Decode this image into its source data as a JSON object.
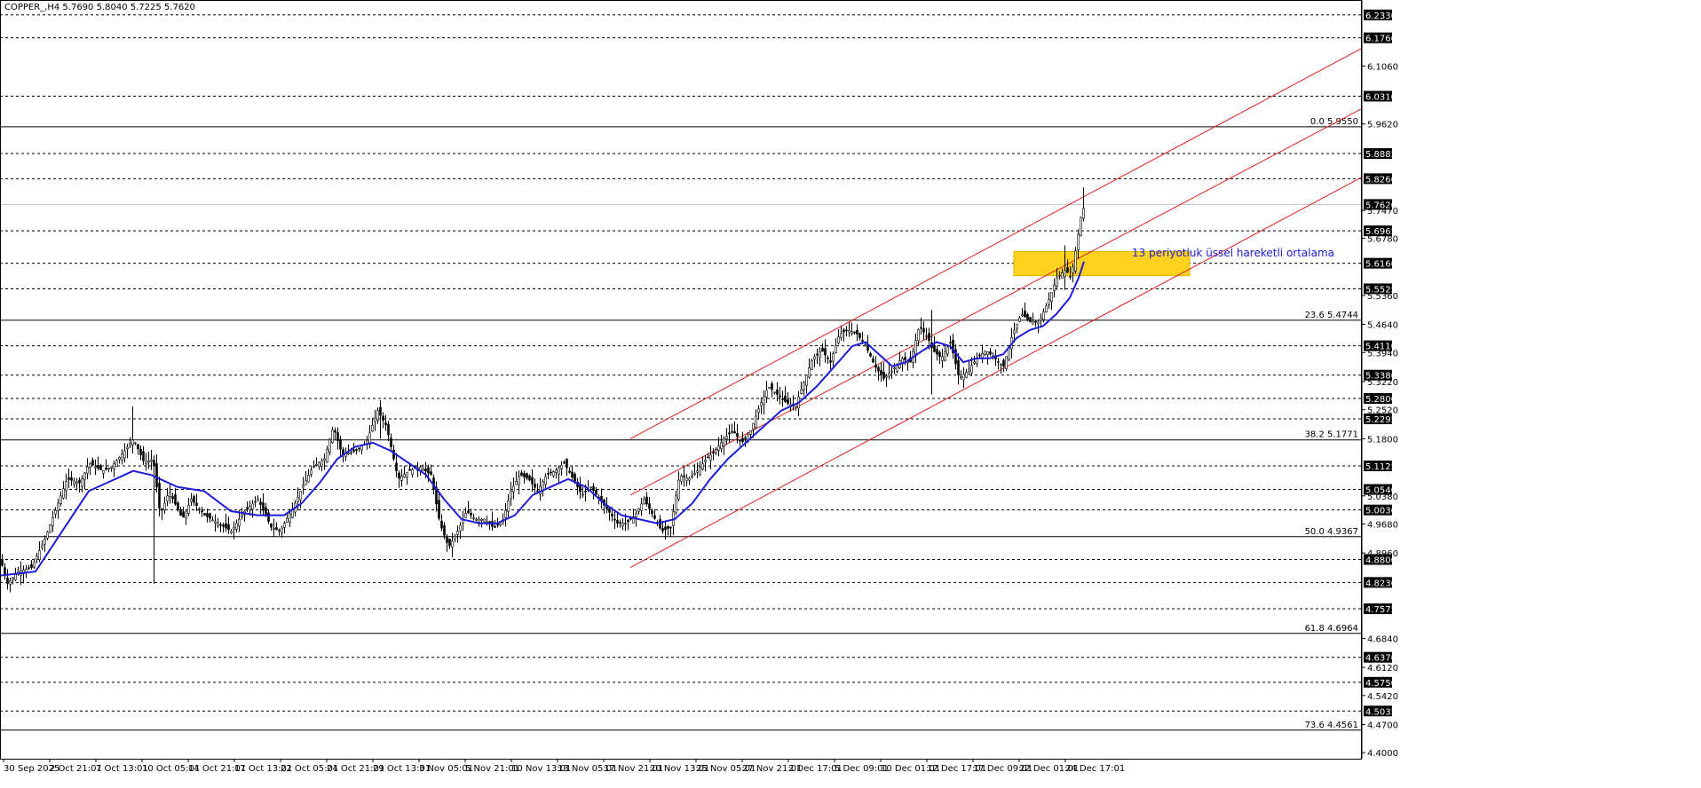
{
  "header": {
    "symbol_info": "COPPER_,H4  5.7690 5.8040 5.7225 5.7620"
  },
  "chart_data": {
    "type": "candlestick",
    "symbol": "COPPER_",
    "timeframe": "H4",
    "ohlc_header": {
      "open": 5.769,
      "high": 5.804,
      "low": 5.7225,
      "close": 5.762
    },
    "y_axis": {
      "min": 4.385,
      "max": 6.27
    },
    "y_ticks": [
      6.106,
      5.962,
      5.747,
      5.678,
      5.536,
      5.464,
      5.394,
      5.322,
      5.252,
      5.18,
      5.038,
      4.968,
      4.896,
      4.684,
      4.612,
      4.542,
      4.47,
      4.4
    ],
    "price_levels": [
      6.233,
      6.176,
      6.031,
      5.8885,
      5.826,
      5.762,
      5.6965,
      5.616,
      5.5525,
      5.411,
      5.338,
      5.28,
      5.2295,
      5.1125,
      5.054,
      5.003,
      4.88,
      4.823,
      4.7575,
      4.637,
      4.575,
      4.5035
    ],
    "dashed_levels": [
      6.233,
      6.176,
      6.031,
      5.8885,
      5.826,
      5.6965,
      5.616,
      5.5525,
      5.411,
      5.338,
      5.28,
      5.2295,
      5.1125,
      5.054,
      5.003,
      4.88,
      4.823,
      4.7575,
      4.637,
      4.575,
      4.5035
    ],
    "fibonacci": [
      {
        "label": "0.0 5.9550",
        "value": 5.955
      },
      {
        "label": "23.6 5.4744",
        "value": 5.4744
      },
      {
        "label": "38.2 5.1771",
        "value": 5.1771
      },
      {
        "label": "50.0 4.9367",
        "value": 4.9367
      },
      {
        "label": "61.8 4.6964",
        "value": 4.6964
      },
      {
        "label": "73.6 4.4561",
        "value": 4.4561
      }
    ],
    "x_tick_labels": [
      "30 Sep 2025",
      "2 Oct 21:01",
      "7 Oct 13:01",
      "10 Oct 05:01",
      "14 Oct 21:01",
      "17 Oct 13:01",
      "22 Oct 05:01",
      "24 Oct 21:01",
      "29 Oct 13:01",
      "3 Nov 05:01",
      "5 Nov 21:01",
      "10 Nov 13:01",
      "13 Nov 05:01",
      "17 Nov 21:01",
      "20 Nov 13:01",
      "25 Nov 05:01",
      "27 Nov 21:01",
      "2 Dec 17:01",
      "5 Dec 09:01",
      "10 Dec 01:01",
      "12 Dec 17:01",
      "17 Dec 09:01",
      "22 Dec 01:01",
      "24 Dec 17:01"
    ],
    "close_path": [
      [
        0,
        4.88
      ],
      [
        8,
        4.82
      ],
      [
        20,
        4.85
      ],
      [
        35,
        4.86
      ],
      [
        50,
        4.93
      ],
      [
        65,
        5.02
      ],
      [
        75,
        5.08
      ],
      [
        90,
        5.07
      ],
      [
        100,
        5.12
      ],
      [
        115,
        5.1
      ],
      [
        125,
        5.11
      ],
      [
        140,
        5.15
      ],
      [
        150,
        5.18
      ],
      [
        162,
        5.12
      ],
      [
        172,
        5.13
      ],
      [
        180,
        4.99
      ],
      [
        190,
        5.05
      ],
      [
        205,
        4.98
      ],
      [
        215,
        5.03
      ],
      [
        230,
        4.99
      ],
      [
        245,
        4.97
      ],
      [
        260,
        4.95
      ],
      [
        275,
        5.0
      ],
      [
        290,
        5.03
      ],
      [
        305,
        4.96
      ],
      [
        315,
        4.95
      ],
      [
        330,
        5.01
      ],
      [
        340,
        5.06
      ],
      [
        352,
        5.11
      ],
      [
        365,
        5.13
      ],
      [
        375,
        5.21
      ],
      [
        385,
        5.14
      ],
      [
        400,
        5.15
      ],
      [
        412,
        5.17
      ],
      [
        425,
        5.25
      ],
      [
        435,
        5.21
      ],
      [
        448,
        5.08
      ],
      [
        460,
        5.1
      ],
      [
        472,
        5.11
      ],
      [
        485,
        5.09
      ],
      [
        495,
        4.97
      ],
      [
        505,
        4.91
      ],
      [
        515,
        4.95
      ],
      [
        525,
        5.0
      ],
      [
        535,
        4.98
      ],
      [
        545,
        4.98
      ],
      [
        555,
        4.96
      ],
      [
        565,
        4.97
      ],
      [
        575,
        5.05
      ],
      [
        585,
        5.09
      ],
      [
        595,
        5.08
      ],
      [
        605,
        5.05
      ],
      [
        615,
        5.09
      ],
      [
        625,
        5.1
      ],
      [
        635,
        5.12
      ],
      [
        645,
        5.08
      ],
      [
        655,
        5.04
      ],
      [
        665,
        5.06
      ],
      [
        675,
        5.03
      ],
      [
        685,
        5.0
      ],
      [
        695,
        4.97
      ],
      [
        705,
        4.97
      ],
      [
        715,
        4.99
      ],
      [
        725,
        5.03
      ],
      [
        735,
        4.99
      ],
      [
        745,
        4.95
      ],
      [
        755,
        4.96
      ],
      [
        765,
        5.09
      ],
      [
        775,
        5.08
      ],
      [
        785,
        5.1
      ],
      [
        795,
        5.13
      ],
      [
        805,
        5.15
      ],
      [
        815,
        5.18
      ],
      [
        825,
        5.2
      ],
      [
        835,
        5.17
      ],
      [
        845,
        5.2
      ],
      [
        855,
        5.26
      ],
      [
        865,
        5.31
      ],
      [
        875,
        5.29
      ],
      [
        885,
        5.27
      ],
      [
        895,
        5.26
      ],
      [
        905,
        5.32
      ],
      [
        915,
        5.38
      ],
      [
        925,
        5.4
      ],
      [
        935,
        5.37
      ],
      [
        945,
        5.44
      ],
      [
        955,
        5.45
      ],
      [
        965,
        5.44
      ],
      [
        975,
        5.41
      ],
      [
        985,
        5.36
      ],
      [
        995,
        5.33
      ],
      [
        1005,
        5.35
      ],
      [
        1015,
        5.38
      ],
      [
        1025,
        5.37
      ],
      [
        1035,
        5.46
      ],
      [
        1045,
        5.43
      ],
      [
        1050,
        5.4
      ],
      [
        1060,
        5.38
      ],
      [
        1070,
        5.42
      ],
      [
        1080,
        5.33
      ],
      [
        1090,
        5.35
      ],
      [
        1100,
        5.38
      ],
      [
        1110,
        5.4
      ],
      [
        1120,
        5.38
      ],
      [
        1130,
        5.36
      ],
      [
        1140,
        5.44
      ],
      [
        1150,
        5.49
      ],
      [
        1160,
        5.47
      ],
      [
        1170,
        5.47
      ],
      [
        1180,
        5.52
      ],
      [
        1190,
        5.58
      ],
      [
        1200,
        5.6
      ],
      [
        1206,
        5.58
      ],
      [
        1212,
        5.66
      ],
      [
        1217,
        5.73
      ],
      [
        1221,
        5.76
      ]
    ],
    "ema13": [
      [
        0,
        4.84
      ],
      [
        40,
        4.85
      ],
      [
        70,
        4.95
      ],
      [
        100,
        5.05
      ],
      [
        130,
        5.08
      ],
      [
        150,
        5.1
      ],
      [
        170,
        5.09
      ],
      [
        200,
        5.06
      ],
      [
        230,
        5.05
      ],
      [
        260,
        5.0
      ],
      [
        290,
        4.99
      ],
      [
        320,
        4.99
      ],
      [
        340,
        5.02
      ],
      [
        360,
        5.07
      ],
      [
        380,
        5.13
      ],
      [
        400,
        5.16
      ],
      [
        420,
        5.17
      ],
      [
        440,
        5.15
      ],
      [
        460,
        5.12
      ],
      [
        480,
        5.09
      ],
      [
        500,
        5.03
      ],
      [
        520,
        4.98
      ],
      [
        540,
        4.97
      ],
      [
        560,
        4.97
      ],
      [
        580,
        4.99
      ],
      [
        600,
        5.04
      ],
      [
        620,
        5.06
      ],
      [
        640,
        5.08
      ],
      [
        660,
        5.06
      ],
      [
        680,
        5.02
      ],
      [
        700,
        4.99
      ],
      [
        720,
        4.98
      ],
      [
        740,
        4.97
      ],
      [
        760,
        4.98
      ],
      [
        780,
        5.02
      ],
      [
        800,
        5.08
      ],
      [
        820,
        5.13
      ],
      [
        840,
        5.17
      ],
      [
        860,
        5.21
      ],
      [
        880,
        5.25
      ],
      [
        900,
        5.27
      ],
      [
        920,
        5.31
      ],
      [
        940,
        5.36
      ],
      [
        960,
        5.41
      ],
      [
        975,
        5.42
      ],
      [
        990,
        5.39
      ],
      [
        1005,
        5.36
      ],
      [
        1020,
        5.37
      ],
      [
        1040,
        5.4
      ],
      [
        1055,
        5.42
      ],
      [
        1070,
        5.41
      ],
      [
        1085,
        5.37
      ],
      [
        1100,
        5.38
      ],
      [
        1115,
        5.38
      ],
      [
        1130,
        5.39
      ],
      [
        1145,
        5.43
      ],
      [
        1160,
        5.45
      ],
      [
        1175,
        5.46
      ],
      [
        1190,
        5.49
      ],
      [
        1205,
        5.53
      ],
      [
        1215,
        5.58
      ],
      [
        1221,
        5.62
      ]
    ],
    "channel_lines": [
      {
        "p1": [
          710,
          5.18
        ],
        "p2": [
          1534,
          6.15
        ]
      },
      {
        "p1": [
          710,
          5.04
        ],
        "p2": [
          1534,
          6.0
        ]
      },
      {
        "p1": [
          710,
          4.86
        ],
        "p2": [
          1534,
          5.83
        ]
      }
    ],
    "support_zone": {
      "x1": 1142,
      "x2": 1340,
      "y_low": 5.585,
      "y_high": 5.645
    },
    "annotation": "13 periyotluk üssel hareketli ortalama"
  }
}
